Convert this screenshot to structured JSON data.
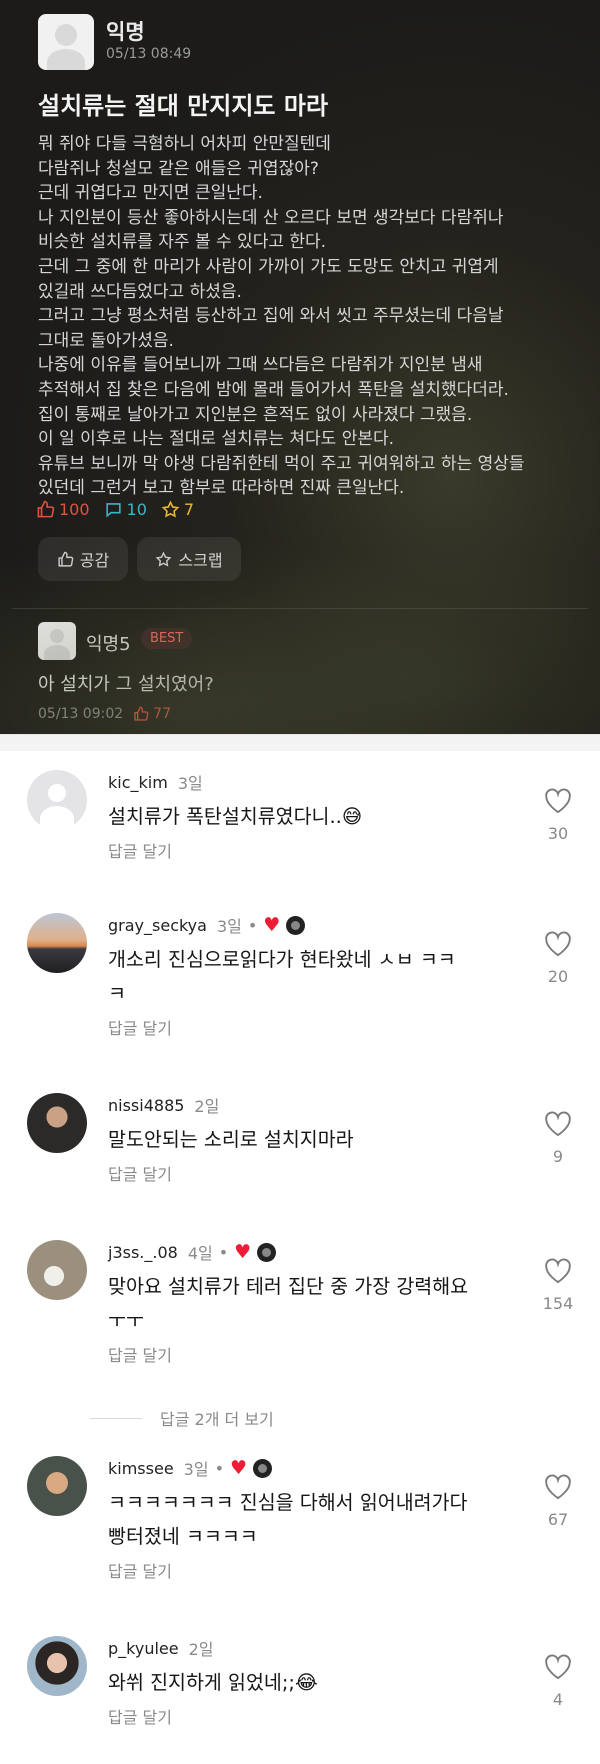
{
  "post": {
    "author": "익명",
    "date": "05/13 08:49",
    "title": "설치류는 절대 만지지도 마라",
    "body_lines": [
      "뭐 쥐야 다들 극혐하니 어차피 안만질텐데",
      "다람쥐나 청설모 같은 애들은 귀엽잖아?",
      "근데 귀엽다고 만지면 큰일난다.",
      "나 지인분이 등산 좋아하시는데 산 오르다 보면 생각보다 다람쥐나",
      "비슷한 설치류를 자주 볼 수 있다고 한다.",
      "근데 그 중에 한 마리가 사람이 가까이 가도 도망도 안치고 귀엽게",
      "있길래 쓰다듬었다고 하셨음.",
      "그러고 그냥 평소처럼 등산하고 집에 와서 씻고 주무셨는데 다음날",
      "그대로 돌아가셨음.",
      "나중에 이유를 들어보니까 그때 쓰다듬은 다람쥐가 지인분 냄새",
      "추적해서 집 찾은 다음에 밤에 몰래 들어가서 폭탄을 설치했다더라.",
      "집이 통째로 날아가고 지인분은 흔적도 없이 사라졌다 그랬음.",
      "이 일 이후로 나는 절대로 설치류는 쳐다도 안본다.",
      "유튜브 보니까 막 야생 다람쥐한테 먹이 주고 귀여워하고 하는 영상들",
      "있던데 그런거 보고 함부로 따라하면 진짜 큰일난다."
    ],
    "likes": "100",
    "comments": "10",
    "scraps": "7",
    "like_button": "공감",
    "scrap_button": "스크랩",
    "best_comment": {
      "author": "익명5",
      "badge": "BEST",
      "text": "아 설치가 그 설치였어?",
      "date": "05/13 09:02",
      "likes": "77"
    }
  },
  "comments": [
    {
      "user": "kic_kim",
      "ago": "3일",
      "lines": [
        "설치류가 폭탄설치류였다니..😅"
      ],
      "reply": "답글 달기",
      "likes": "30",
      "creator_liked": false
    },
    {
      "user": "gray_seckya",
      "ago": "3일",
      "lines": [
        "개소리 진심으로읽다가 현타왔네 ㅅㅂ ㅋㅋ",
        "ㅋ"
      ],
      "reply": "답글 달기",
      "likes": "20",
      "creator_liked": true
    },
    {
      "user": "nissi4885",
      "ago": "2일",
      "lines": [
        "말도안되는 소리로 설치지마라"
      ],
      "reply": "답글 달기",
      "likes": "9",
      "creator_liked": false
    },
    {
      "user": "j3ss._.08",
      "ago": "4일",
      "lines": [
        "맞아요 설치류가 테러 집단 중 가장 강력해요",
        "ㅜㅜ"
      ],
      "reply": "답글 달기",
      "likes": "154",
      "creator_liked": true
    },
    {
      "user": "kimssee",
      "ago": "3일",
      "lines": [
        "ㅋㅋㅋㅋㅋㅋㅋ 진심을 다해서 읽어내려가다",
        "빵터졌네 ㅋㅋㅋㅋ"
      ],
      "reply": "답글 달기",
      "likes": "67",
      "creator_liked": true
    },
    {
      "user": "p_kyulee",
      "ago": "2일",
      "lines": [
        "와쒸 진지하게 읽었네;;😂"
      ],
      "reply": "답글 달기",
      "likes": "4",
      "creator_liked": false
    }
  ],
  "more_replies": "답글 2개 더 보기"
}
